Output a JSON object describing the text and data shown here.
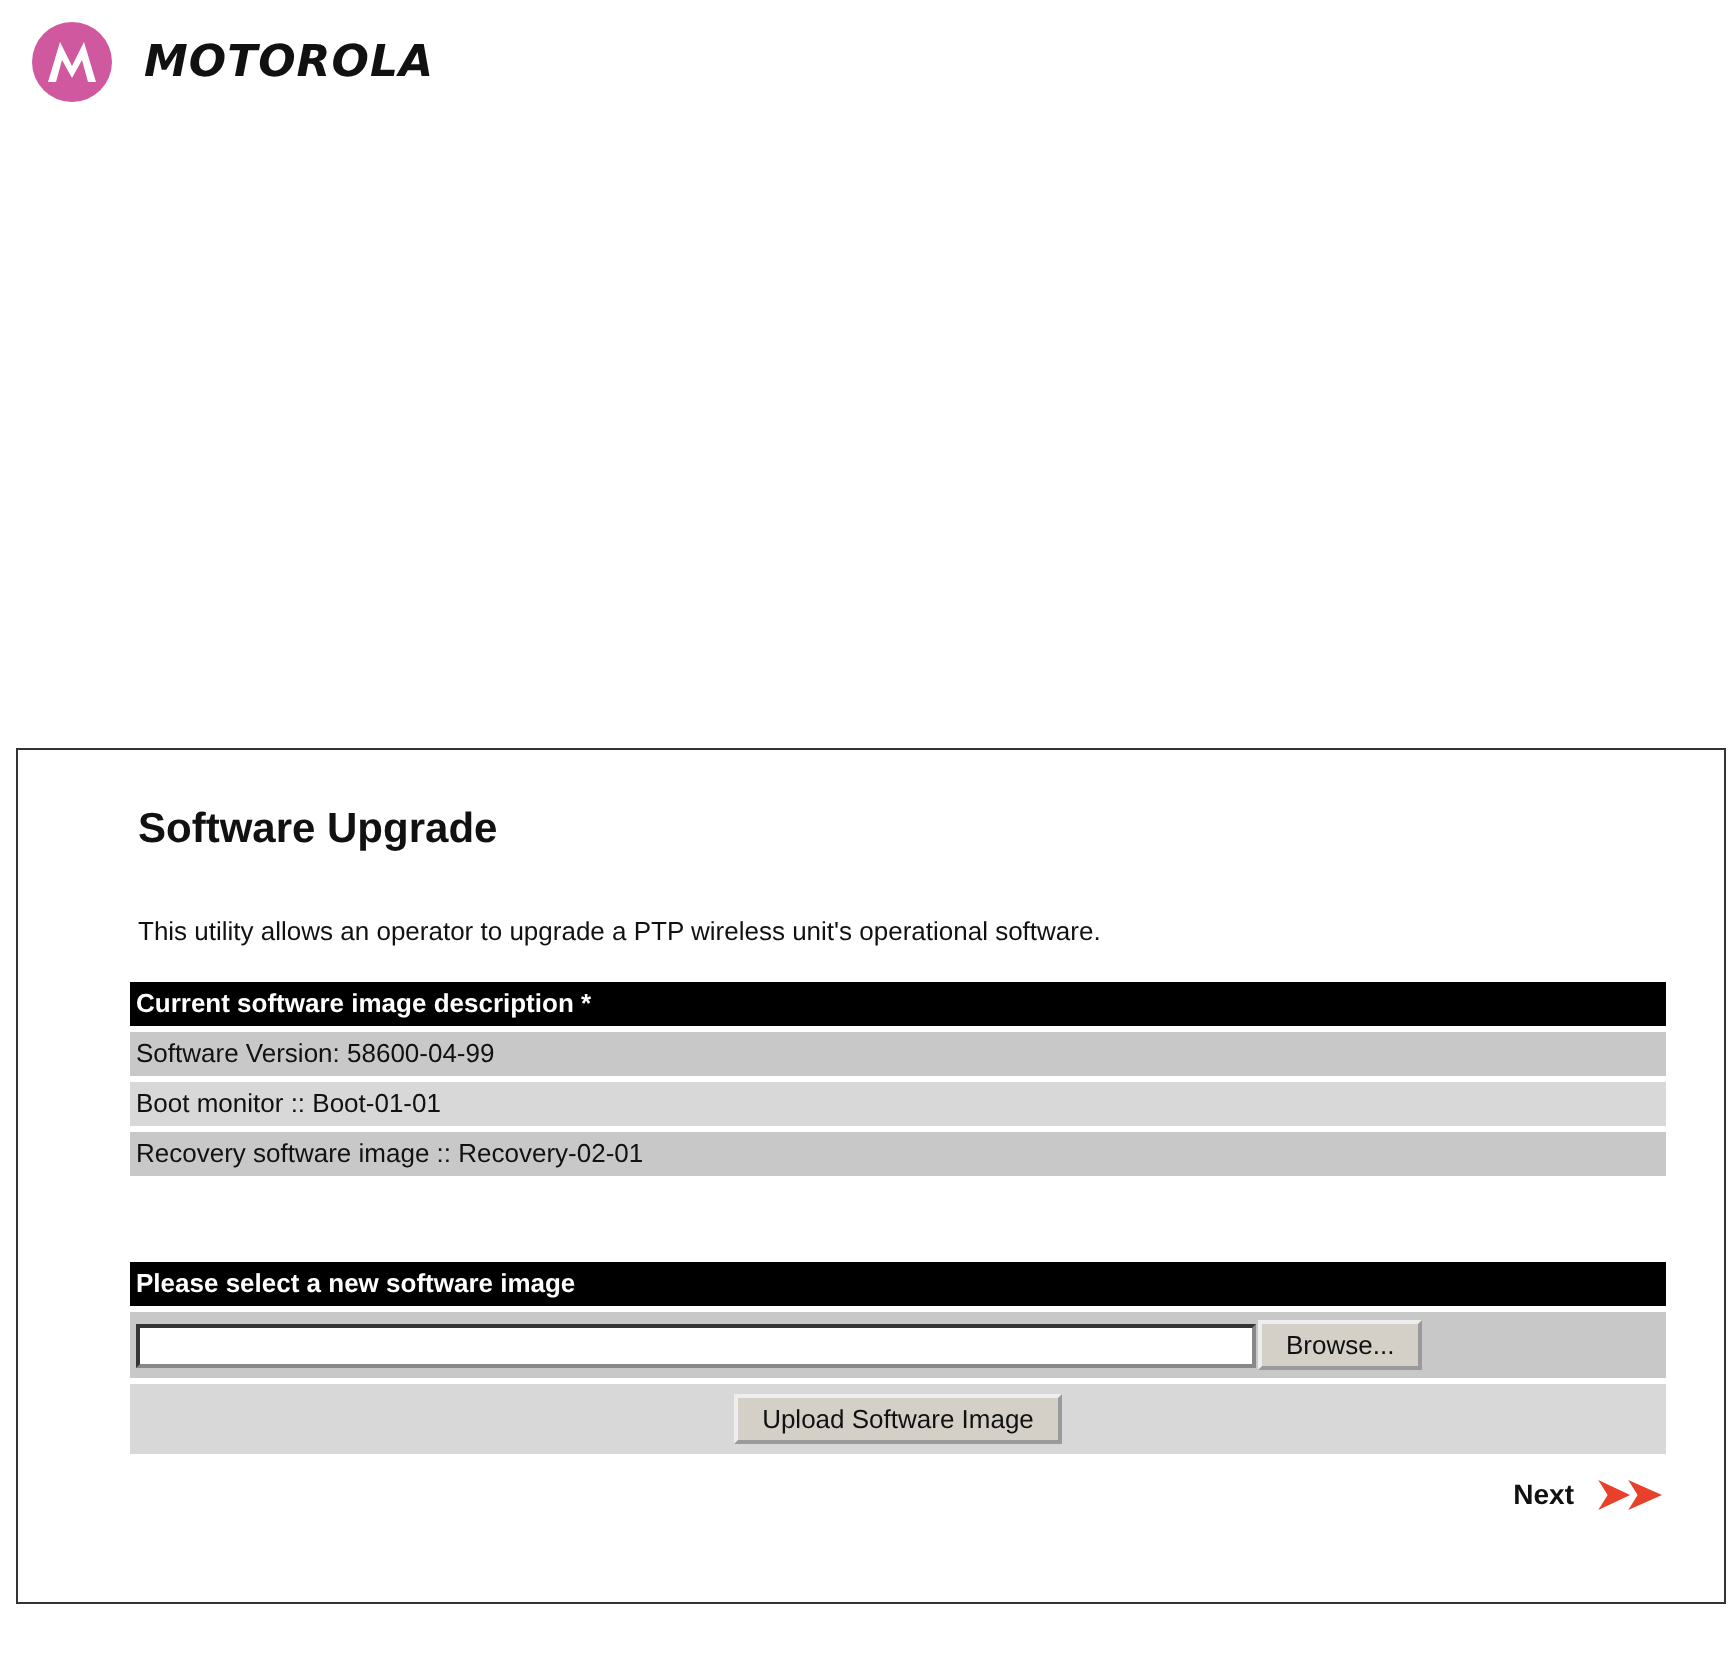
{
  "brand": {
    "name": "MOTOROLA"
  },
  "screen": {
    "title": "Software Upgrade",
    "intro": "This utility allows an operator to upgrade a PTP wireless unit's operational software.",
    "current_image": {
      "header": "Current software image description *",
      "rows": [
        "Software Version: 58600-04-99",
        "Boot monitor :: Boot-01-01",
        "Recovery software image :: Recovery-02-01"
      ]
    },
    "new_image": {
      "header": "Please select a new software image",
      "browse_button": "Browse...",
      "upload_button": "Upload Software Image"
    },
    "next_link": "Next"
  }
}
